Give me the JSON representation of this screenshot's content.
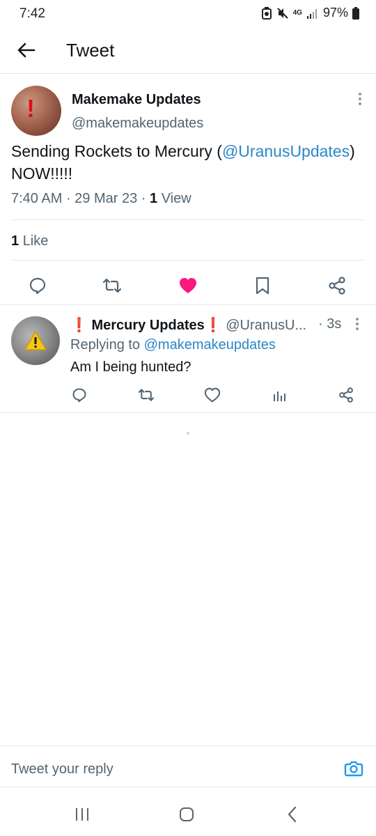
{
  "status_bar": {
    "time": "7:42",
    "network": "4G",
    "battery": "97%"
  },
  "header": {
    "title": "Tweet"
  },
  "main_tweet": {
    "author_name": "Makemake Updates",
    "author_handle": "@makemakeupdates",
    "text_before": "Sending Rockets to Mercury (",
    "mention": "@UranusUpdates",
    "text_after": ") NOW!!!!!",
    "time": "7:40 AM",
    "date": "29 Mar 23",
    "view_count": "1",
    "view_label": "View",
    "like_count": "1",
    "like_label": "Like",
    "liked": true,
    "accent_like": "#f91880"
  },
  "reply": {
    "author_name": "Mercury Updates",
    "name_emoji": "❗",
    "author_handle": "@UranusU...",
    "time": "· 3s",
    "replying_prefix": "Replying to",
    "replying_to": "@makemakeupdates",
    "text": "Am I being hunted?"
  },
  "composer": {
    "placeholder": "Tweet your reply"
  },
  "colors": {
    "link": "#2b87c8",
    "secondary_text": "#536471",
    "divider": "#e1e8ed"
  }
}
